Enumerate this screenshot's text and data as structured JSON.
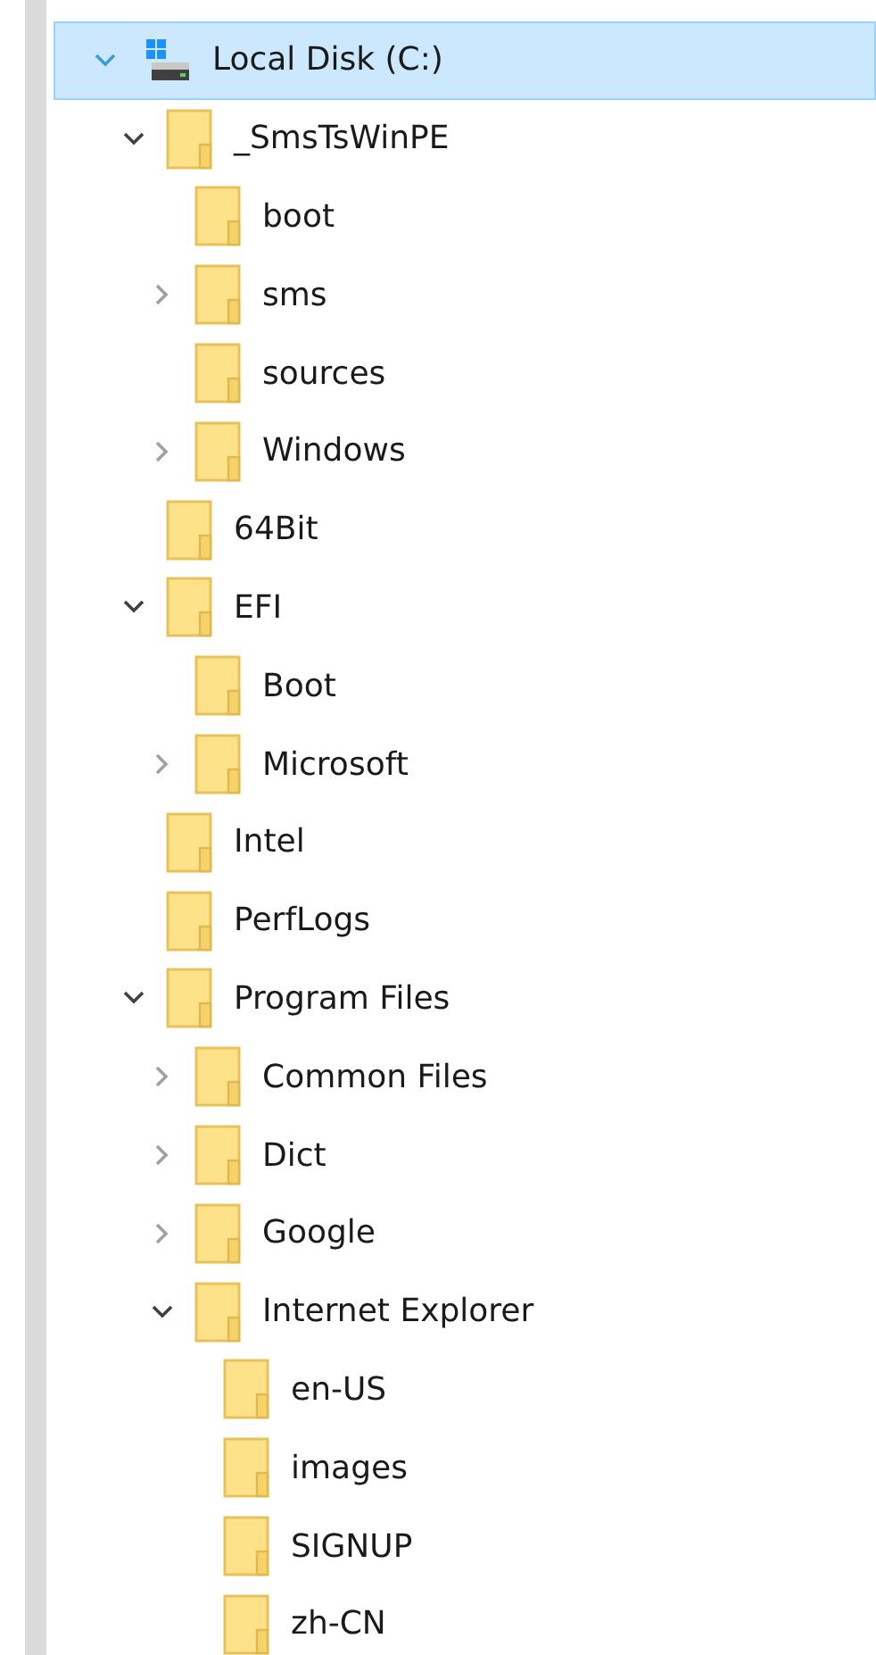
{
  "tree": [
    {
      "label": "Local Disk (C:)",
      "kind": "drive",
      "selected": true,
      "expanded": true,
      "children": [
        {
          "label": "_SmsTsWinPE",
          "kind": "folder",
          "selected": false,
          "expanded": true,
          "children": [
            {
              "label": "boot",
              "kind": "folder",
              "selected": false
            },
            {
              "label": "sms",
              "kind": "folder",
              "selected": false,
              "expanded": false
            },
            {
              "label": "sources",
              "kind": "folder",
              "selected": false
            },
            {
              "label": "Windows",
              "kind": "folder",
              "selected": false,
              "expanded": false
            }
          ]
        },
        {
          "label": "64Bit",
          "kind": "folder",
          "selected": false
        },
        {
          "label": "EFI",
          "kind": "folder",
          "selected": false,
          "expanded": true,
          "children": [
            {
              "label": "Boot",
              "kind": "folder",
              "selected": false
            },
            {
              "label": "Microsoft",
              "kind": "folder",
              "selected": false,
              "expanded": false
            }
          ]
        },
        {
          "label": "Intel",
          "kind": "folder",
          "selected": false
        },
        {
          "label": "PerfLogs",
          "kind": "folder",
          "selected": false
        },
        {
          "label": "Program Files",
          "kind": "folder",
          "selected": false,
          "expanded": true,
          "children": [
            {
              "label": "Common Files",
              "kind": "folder",
              "selected": false,
              "expanded": false
            },
            {
              "label": "Dict",
              "kind": "folder",
              "selected": false,
              "expanded": false
            },
            {
              "label": "Google",
              "kind": "folder",
              "selected": false,
              "expanded": false
            },
            {
              "label": "Internet Explorer",
              "kind": "folder",
              "selected": false,
              "expanded": true,
              "children": [
                {
                  "label": "en-US",
                  "kind": "folder",
                  "selected": false
                },
                {
                  "label": "images",
                  "kind": "folder",
                  "selected": false
                },
                {
                  "label": "SIGNUP",
                  "kind": "folder",
                  "selected": false
                },
                {
                  "label": "zh-CN",
                  "kind": "folder",
                  "selected": false
                }
              ]
            }
          ]
        }
      ]
    }
  ]
}
